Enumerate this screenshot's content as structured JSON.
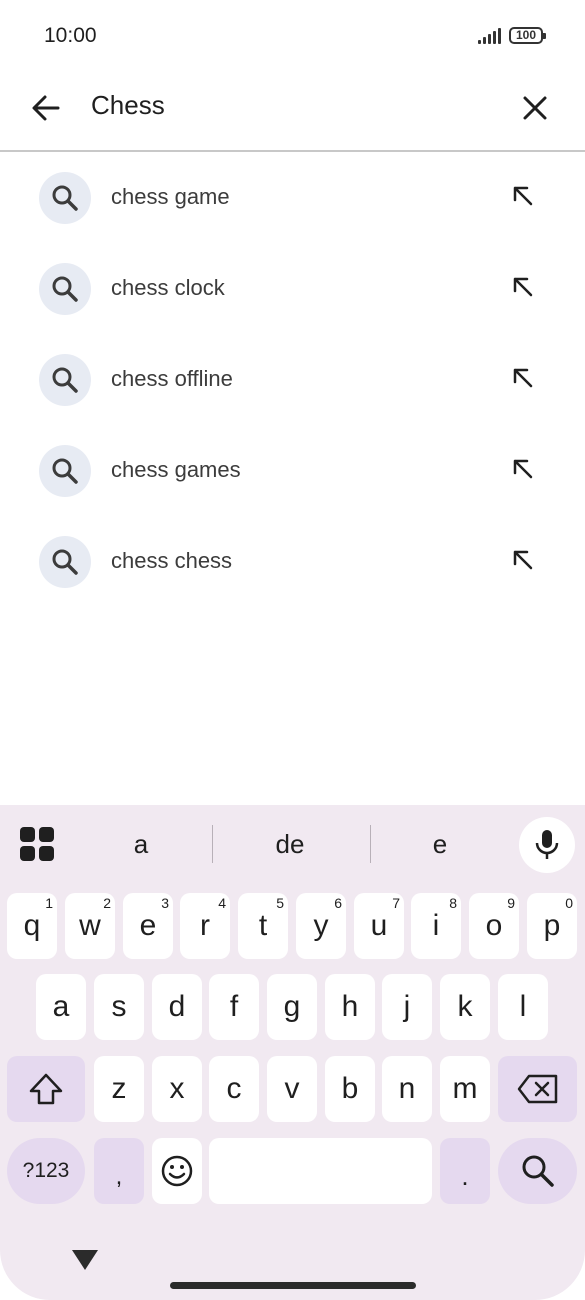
{
  "status_bar": {
    "time": "10:00",
    "battery": "100"
  },
  "search": {
    "query": "Chess"
  },
  "suggestions": [
    {
      "label": "chess game"
    },
    {
      "label": "chess clock"
    },
    {
      "label": "chess offline"
    },
    {
      "label": "chess games"
    },
    {
      "label": "chess chess"
    }
  ],
  "keyboard": {
    "suggestions": [
      "a",
      "de",
      "e"
    ],
    "row1": [
      {
        "key": "q",
        "hint": "1"
      },
      {
        "key": "w",
        "hint": "2"
      },
      {
        "key": "e",
        "hint": "3"
      },
      {
        "key": "r",
        "hint": "4"
      },
      {
        "key": "t",
        "hint": "5"
      },
      {
        "key": "y",
        "hint": "6"
      },
      {
        "key": "u",
        "hint": "7"
      },
      {
        "key": "i",
        "hint": "8"
      },
      {
        "key": "o",
        "hint": "9"
      },
      {
        "key": "p",
        "hint": "0"
      }
    ],
    "row2": [
      "a",
      "s",
      "d",
      "f",
      "g",
      "h",
      "j",
      "k",
      "l"
    ],
    "row3": [
      "z",
      "x",
      "c",
      "v",
      "b",
      "n",
      "m"
    ],
    "symbols_label": "?123",
    "comma_label": ",",
    "period_label": ".",
    "colors": {
      "background": "#f1e9f1",
      "function_key": "#e5d9ef",
      "key": "#ffffff"
    }
  }
}
